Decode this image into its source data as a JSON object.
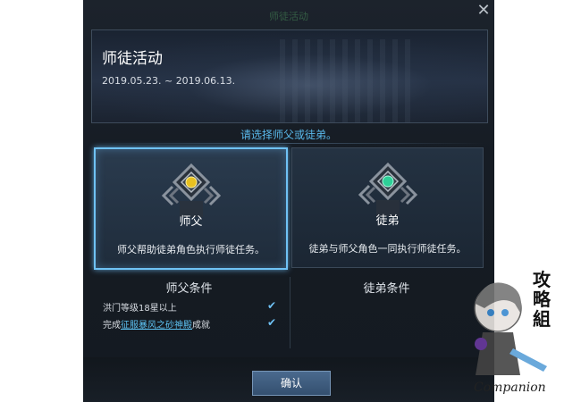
{
  "dialog": {
    "top_title": "师徒活动",
    "close_icon": "close-icon"
  },
  "banner": {
    "title": "师徒活动",
    "date_range": "2019.05.23. ~ 2019.06.13."
  },
  "prompt": "请选择师父或徒弟。",
  "cards": [
    {
      "label": "师父",
      "desc": "师父帮助徒弟角色执行师徒任务。",
      "selected": true,
      "gem_color": "#e8c020"
    },
    {
      "label": "徒弟",
      "desc": "徒弟与师父角色一同执行师徒任务。",
      "selected": false,
      "gem_color": "#2ed098"
    }
  ],
  "conditions": {
    "master_title": "师父条件",
    "apprentice_title": "徒弟条件",
    "master_items": [
      {
        "prefix": "洪门等级18星以上",
        "link": "",
        "suffix": "",
        "checked": true
      },
      {
        "prefix": "完成",
        "link": "征服暴风之砂神殿",
        "suffix": "成就",
        "checked": true
      }
    ]
  },
  "buttons": {
    "confirm": "确认"
  },
  "watermark": {
    "text": "Companion",
    "cn": "攻略组"
  },
  "colors": {
    "accent": "#6fc2f5",
    "prompt": "#59b8ea",
    "link": "#5cc0f0"
  }
}
